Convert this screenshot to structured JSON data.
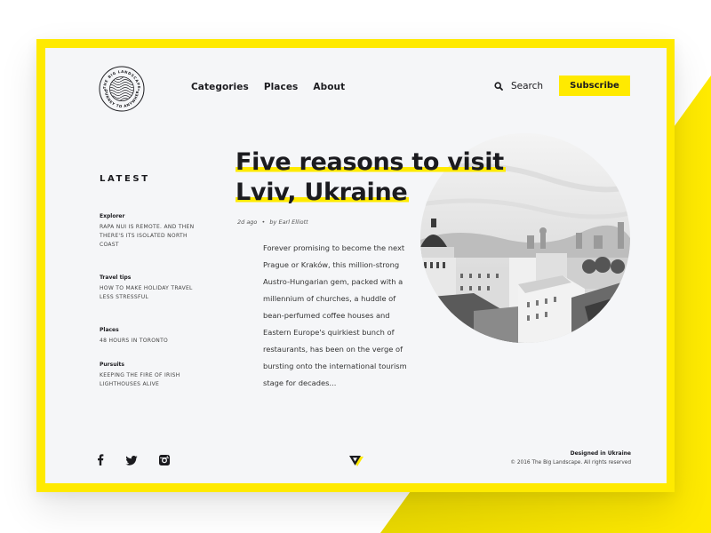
{
  "brand": {
    "logo_top_text": "THE BIG LANDSCAPE",
    "logo_bottom_text": "JOURNEY TO ANYWHERE",
    "accent_color": "#ffea00",
    "text_color": "#1b1b1f",
    "panel_color": "#f5f6f8"
  },
  "nav": {
    "items": [
      {
        "label": "Categories"
      },
      {
        "label": "Places"
      },
      {
        "label": "About"
      }
    ],
    "search_icon": "search-icon",
    "search_label": "Search",
    "subscribe_label": "Subscribe"
  },
  "sidebar": {
    "title": "LATEST",
    "items": [
      {
        "category": "Explorer",
        "title": "Rapa Nui is remote. And then there's its isolated north coast"
      },
      {
        "category": "Travel tips",
        "title": "How to make holiday travel less stressful"
      },
      {
        "category": "Places",
        "title": "48 hours in Toronto"
      },
      {
        "category": "Pursuits",
        "title": "Keeping the fire of Irish lighthouses alive"
      }
    ]
  },
  "article": {
    "headline_line1": "Five reasons to visit",
    "headline_line2": "Lviv, Ukraine",
    "time_ago": "2d ago",
    "separator": "•",
    "author": "by Earl Elliott",
    "excerpt": "Forever promising to become the next Prague or Kraków, this million-strong Austro-Hungarian gem, packed with a millennium of churches, a huddle of bean-perfumed coffee houses and Eastern Europe's quirkiest bunch of restaurants, has been on the verge of bursting onto the international tourism stage for decades...",
    "image_alt": "Black and white rooftop view of Lviv old town"
  },
  "footer": {
    "social": [
      {
        "icon": "facebook-icon"
      },
      {
        "icon": "twitter-icon"
      },
      {
        "icon": "instagram-icon"
      }
    ],
    "brand_mark_icon": "triangle-logo-icon",
    "designed_in": "Designed in Ukraine",
    "copyright": "© 2016 The Big Landscape. All rights reserved"
  }
}
